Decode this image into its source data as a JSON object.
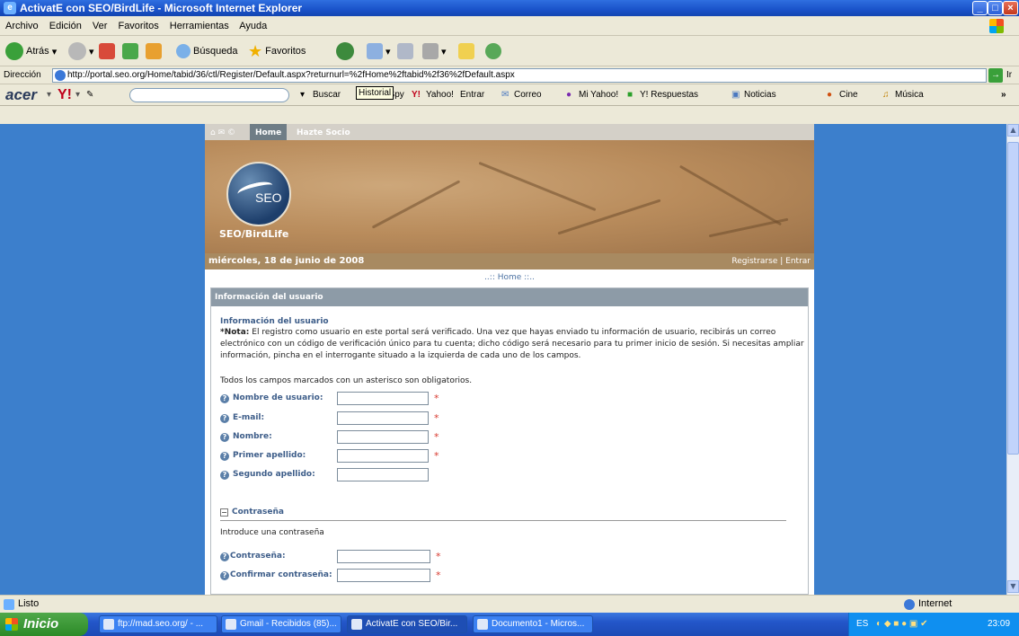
{
  "window": {
    "title": "ActivatE con SEO/BirdLife - Microsoft Internet Explorer"
  },
  "menu": [
    "Archivo",
    "Edición",
    "Ver",
    "Favoritos",
    "Herramientas",
    "Ayuda"
  ],
  "toolbar": {
    "back_label": "Atrás",
    "search_label": "Búsqueda",
    "favorites_label": "Favoritos"
  },
  "address": {
    "label": "Dirección",
    "url": "http://portal.seo.org/Home/tabid/36/ctl/Register/Default.aspx?returnurl=%2fHome%2ftabid%2f36%2fDefault.aspx",
    "tooltip": "Historial",
    "go_label": "Ir"
  },
  "acerbar": {
    "search_label": "Buscar",
    "anti_spy": "Anti-Spy",
    "yahoo": "Yahoo!",
    "entrar": "Entrar",
    "correo": "Correo",
    "mi_yahoo": "Mi Yahoo!",
    "respuestas": "Y! Respuestas",
    "noticias": "Noticias",
    "cine": "Cine",
    "musica": "Música"
  },
  "site": {
    "nav": {
      "home": "Home",
      "socio": "Hazte Socio"
    },
    "brand": "SEO/BirdLife",
    "logo_text": "SEO",
    "date": "miércoles, 18 de junio de 2008",
    "register": "Registrarse",
    "sep": "|",
    "login": "Entrar",
    "breadcrumb": "..:: Home ::.."
  },
  "panel": {
    "header": "Información del usuario",
    "title": "Información del usuario",
    "note_label": "*Nota:",
    "note": "El registro como usuario en este portal será verificado. Una vez que hayas enviado tu información de usuario, recibirás un correo electrónico con un código de verificación único para tu cuenta; dicho código será necesario para tu primer inicio de sesión. Si necesitas ampliar información, pincha en el interrogante situado a la izquierda de cada uno de los campos.",
    "mandatory": "Todos los campos marcados con un asterisco son obligatorios.",
    "fields": [
      "Nombre de usuario:",
      "E-mail:",
      "Nombre:",
      "Primer apellido:",
      "Segundo apellido:"
    ],
    "required_mark": "*",
    "password_section": "Contraseña",
    "password_intro": "Introduce una contraseña",
    "password_fields": [
      "Contraseña:",
      "Confirmar contraseña:"
    ]
  },
  "status": {
    "text": "Listo",
    "zone": "Internet"
  },
  "taskbar": {
    "start": "Inicio",
    "tasks": [
      "ftp://mad.seo.org/ - ...",
      "Gmail - Recibidos (85)...",
      "ActivatE con SEO/Bir...",
      "Documento1 - Micros..."
    ],
    "lang": "ES",
    "clock": "23:09"
  }
}
